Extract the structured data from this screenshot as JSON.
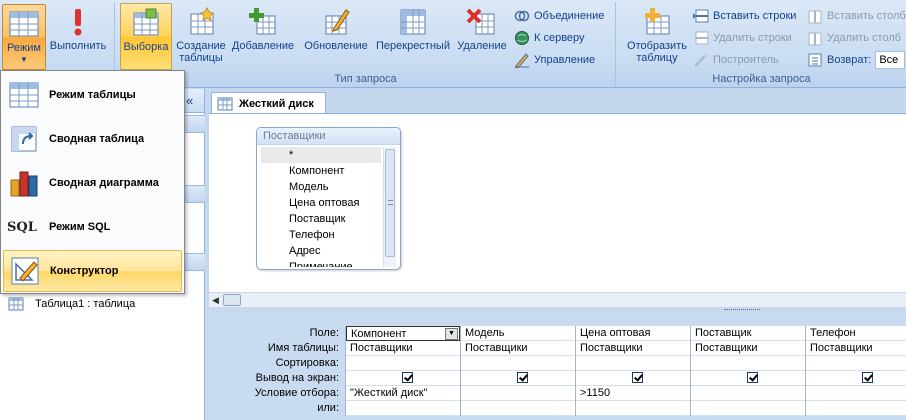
{
  "ribbon": {
    "mode_button": "Режим",
    "run_button": "Выполнить",
    "select_button": "Выборка",
    "create_table": [
      "Создание",
      "таблицы"
    ],
    "append_button": "Добавление",
    "update_button": "Обновление",
    "crosstab_button": "Перекрестный",
    "delete_button": "Удаление",
    "union_button": "Объединение",
    "server_button": "К серверу",
    "manage_button": "Управление",
    "query_type_label": "Тип запроса",
    "show_table": [
      "Отобразить",
      "таблицу"
    ],
    "insert_rows": "Вставить строки",
    "delete_rows": "Удалить строки",
    "builder": "Построитель",
    "insert_cols": "Вставить столб",
    "delete_cols": "Удалить столб",
    "return_label": "Возврат:",
    "return_value": "Все",
    "query_setup_label": "Настройка запроса"
  },
  "menu": {
    "items": [
      {
        "label": "Режим таблицы",
        "icon": "datasheet-icon"
      },
      {
        "label": "Сводная таблица",
        "icon": "pivot-table-icon"
      },
      {
        "label": "Сводная диаграмма",
        "icon": "pivot-chart-icon"
      },
      {
        "label": "Режим SQL",
        "icon": "sql-icon"
      },
      {
        "label": "Конструктор",
        "icon": "design-icon"
      }
    ],
    "sql_glyph": "SQL"
  },
  "nav": {
    "collapse": "«",
    "table_item": "Таблица1 : таблица"
  },
  "document": {
    "tab_title": "Жесткий диск",
    "field_list": {
      "title": "Поставщики",
      "items": [
        "*",
        "Компонент",
        "Модель",
        "Цена оптовая",
        "Поставщик",
        "Телефон",
        "Адрес",
        "Примечание"
      ]
    },
    "row_labels": [
      "Поле:",
      "Имя таблицы:",
      "Сортировка:",
      "Вывод на экран:",
      "Условие отбора:",
      "или:"
    ],
    "columns": [
      {
        "field": "Компонент",
        "table": "Поставщики",
        "show": true,
        "criteria": "\"Жесткий диск\""
      },
      {
        "field": "Модель",
        "table": "Поставщики",
        "show": true,
        "criteria": ""
      },
      {
        "field": "Цена оптовая",
        "table": "Поставщики",
        "show": true,
        "criteria": ">1150"
      },
      {
        "field": "Поставщик",
        "table": "Поставщики",
        "show": true,
        "criteria": ""
      },
      {
        "field": "Телефон",
        "table": "Поставщики",
        "show": true,
        "criteria": ""
      }
    ]
  },
  "colors": {
    "ribbon_bg": "#c9dcf2",
    "highlight": "#ffd35b",
    "grid_bg": "#c9dbf0"
  }
}
